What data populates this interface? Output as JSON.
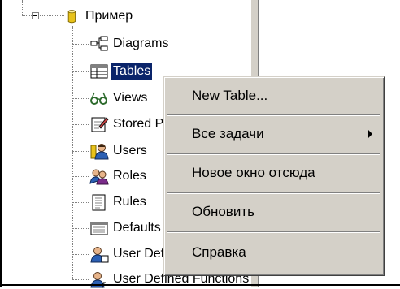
{
  "tree": {
    "root": {
      "label": "Пример",
      "icon": "database-icon"
    },
    "items": [
      {
        "label": "Diagrams",
        "icon": "diagram-icon"
      },
      {
        "label": "Tables",
        "icon": "table-icon",
        "selected": true
      },
      {
        "label": "Views",
        "icon": "glasses-icon"
      },
      {
        "label": "Stored Procedures",
        "icon": "stored-procedure-icon"
      },
      {
        "label": "Users",
        "icon": "user-icon"
      },
      {
        "label": "Roles",
        "icon": "roles-icon"
      },
      {
        "label": "Rules",
        "icon": "rules-icon"
      },
      {
        "label": "Defaults",
        "icon": "defaults-icon"
      },
      {
        "label": "User Defined Data Types",
        "icon": "user-type-icon"
      },
      {
        "label": "User Defined Functions",
        "icon": "user-function-icon"
      }
    ]
  },
  "context_menu": {
    "items": [
      {
        "label": "New Table..."
      },
      {
        "label": "Все задачи",
        "submenu": true
      },
      {
        "label": "Новое окно отсюда"
      },
      {
        "label": "Обновить"
      },
      {
        "label": "Справка"
      }
    ]
  },
  "colors": {
    "selection": "#0a246a",
    "menu_bg": "#d4d0c8"
  }
}
